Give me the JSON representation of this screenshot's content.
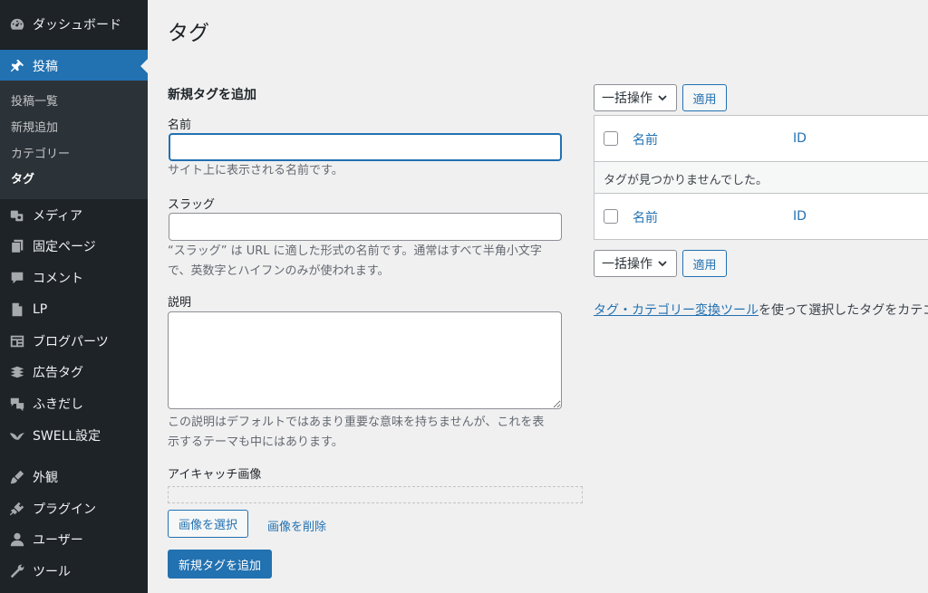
{
  "sidebar": {
    "items": [
      {
        "label": "ダッシュボード",
        "icon": "dashboard-icon"
      },
      {
        "label": "投稿",
        "icon": "pin-icon"
      },
      {
        "label": "メディア",
        "icon": "media-icon"
      },
      {
        "label": "固定ページ",
        "icon": "page-icon"
      },
      {
        "label": "コメント",
        "icon": "comment-icon"
      },
      {
        "label": "LP",
        "icon": "document-icon"
      },
      {
        "label": "ブログパーツ",
        "icon": "layout-icon"
      },
      {
        "label": "広告タグ",
        "icon": "stack-icon"
      },
      {
        "label": "ふきだし",
        "icon": "chat-bubbles-icon"
      },
      {
        "label": "SWELL設定",
        "icon": "swallow-icon"
      },
      {
        "label": "外観",
        "icon": "brush-icon"
      },
      {
        "label": "プラグイン",
        "icon": "plug-icon"
      },
      {
        "label": "ユーザー",
        "icon": "user-icon"
      },
      {
        "label": "ツール",
        "icon": "wrench-icon"
      }
    ],
    "submenu": [
      "投稿一覧",
      "新規追加",
      "カテゴリー",
      "タグ"
    ]
  },
  "page": {
    "title": "タグ"
  },
  "form": {
    "heading": "新規タグを追加",
    "name_label": "名前",
    "name_value": "",
    "name_help": "サイト上に表示される名前です。",
    "slug_label": "スラッグ",
    "slug_value": "",
    "slug_help_line1": "“スラッグ” は URL に適した形式の名前です。通常はすべて半角小文字",
    "slug_help_line2": "で、英数字とハイフンのみが使われます。",
    "desc_label": "説明",
    "desc_value": "",
    "desc_help_line1": "この説明はデフォルトではあまり重要な意味を持ちませんが、これを表",
    "desc_help_line2": "示するテーマも中にはあります。",
    "eyecatch_label": "アイキャッチ画像",
    "select_image": "画像を選択",
    "remove_image": "画像を削除",
    "submit": "新規タグを追加"
  },
  "list": {
    "bulk_action": "一括操作",
    "apply": "適用",
    "col_name": "名前",
    "col_id": "ID",
    "empty": "タグが見つかりませんでした。"
  },
  "note": {
    "link": "タグ・カテゴリー変換ツール",
    "text": "を使って選択したタグをカテゴリ"
  },
  "colors": {
    "accent": "#2271b1",
    "sidebar_bg": "#1d2327",
    "page_bg": "#f0f0f1"
  }
}
